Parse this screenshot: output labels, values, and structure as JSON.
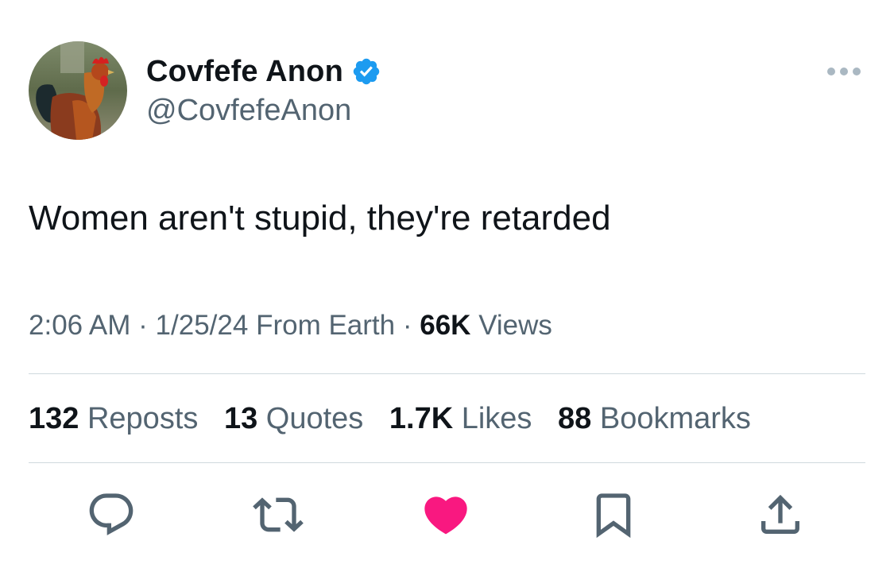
{
  "author": {
    "display_name": "Covfefe Anon",
    "handle": "@CovfefeAnon",
    "verified": true,
    "avatar_icon": "rooster-avatar"
  },
  "tweet": {
    "text": "Women aren't stupid, they're retarded"
  },
  "meta": {
    "time": "2:06 AM",
    "sep1": "·",
    "date": "1/25/24",
    "source": "From Earth",
    "sep2": "·",
    "views_count": "66K",
    "views_label": "Views"
  },
  "stats": [
    {
      "count": "132",
      "label": "Reposts"
    },
    {
      "count": "13",
      "label": "Quotes"
    },
    {
      "count": "1.7K",
      "label": "Likes"
    },
    {
      "count": "88",
      "label": "Bookmarks"
    }
  ],
  "actions": {
    "reply_icon": "reply-icon",
    "repost_icon": "repost-icon",
    "like_icon": "heart-icon",
    "bookmark_icon": "bookmark-icon",
    "share_icon": "share-icon"
  },
  "colors": {
    "verified_blue": "#1d9bf0",
    "like_pink": "#f91880",
    "icon_gray": "#536471"
  }
}
